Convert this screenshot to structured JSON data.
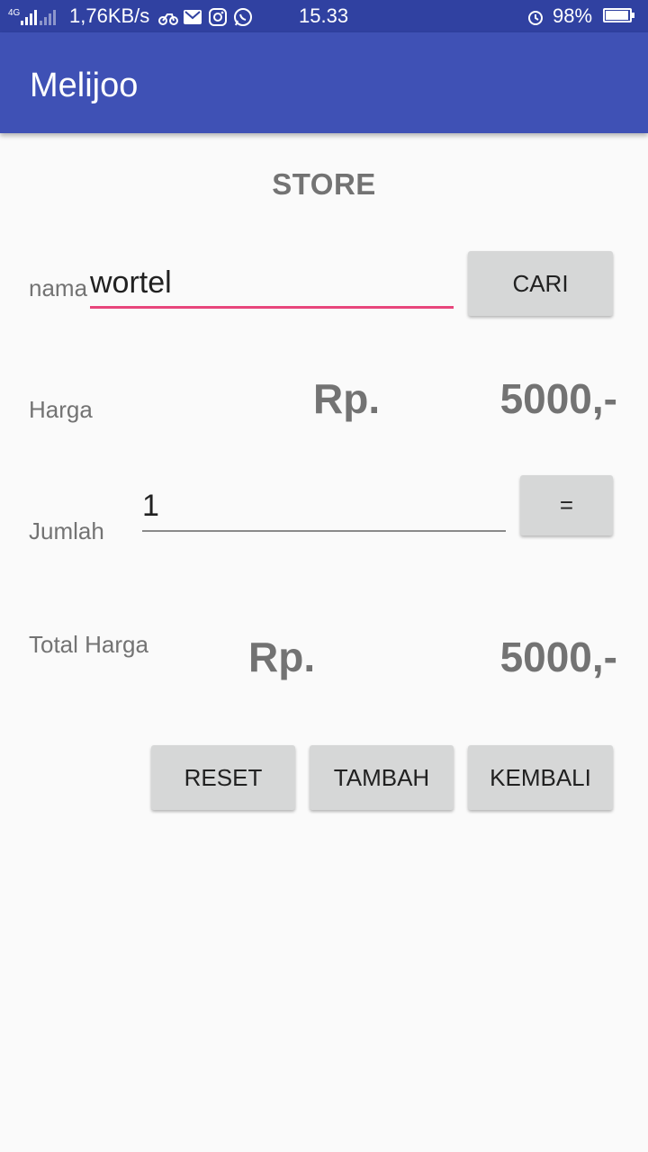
{
  "status_bar": {
    "network_type": "4G",
    "speed": "1,76KB/s",
    "time": "15.33",
    "battery": "98%",
    "battery_level": 0.98,
    "icons": [
      "signal-icon",
      "signal-icon",
      "motorbike-icon",
      "gmail-icon",
      "instagram-icon",
      "whatsapp-icon",
      "alarm-icon",
      "battery-icon"
    ]
  },
  "app_bar": {
    "title": "Melijoo"
  },
  "store": {
    "title": "STORE",
    "nama_label": "nama",
    "nama_value": "wortel",
    "cari_button": "CARI",
    "harga_label": "Harga",
    "harga_currency": "Rp.",
    "harga_value": "5000,-",
    "jumlah_label": "Jumlah",
    "jumlah_value": "1",
    "equals_button": "=",
    "total_label": "Total Harga",
    "total_currency": "Rp.",
    "total_value": "5000,-",
    "reset_button": "RESET",
    "tambah_button": "TAMBAH",
    "kembali_button": "KEMBALI"
  },
  "colors": {
    "status_bar": "#3041a1",
    "app_bar": "#3f51b5",
    "accent_underline": "#e8467c",
    "button_bg": "#d6d7d7"
  }
}
